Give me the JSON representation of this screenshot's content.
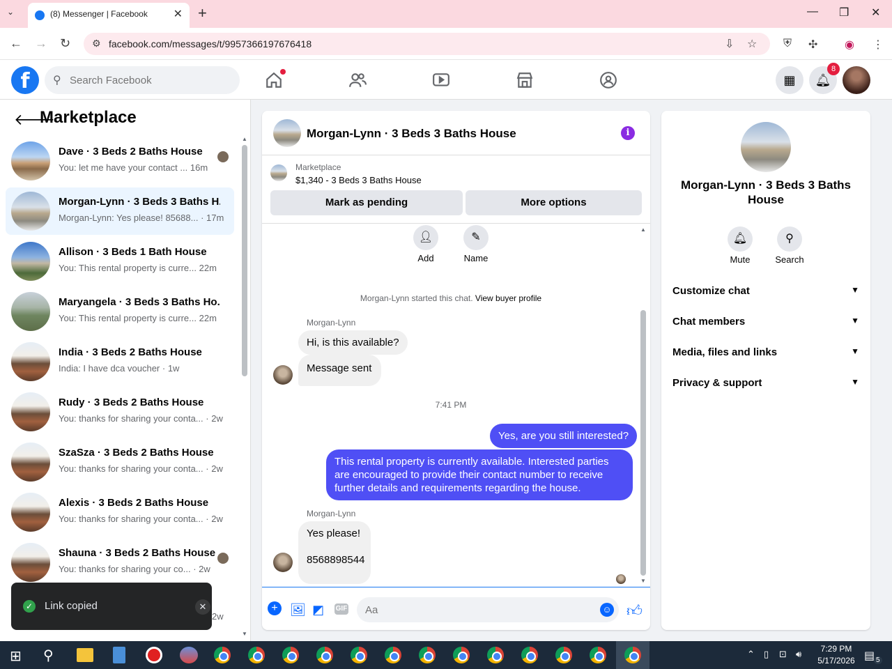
{
  "browser": {
    "tab_title": "(8) Messenger | Facebook",
    "url": "facebook.com/messages/t/9957366197676418"
  },
  "header": {
    "search_placeholder": "Search Facebook",
    "notification_count": "8"
  },
  "sidebar": {
    "title": "Marketplace",
    "conversations": [
      {
        "name": "Dave · 3 Beds 2 Baths House",
        "preview": "You: let me have your contact ...",
        "time": "16m"
      },
      {
        "name": "Morgan-Lynn · 3 Beds 3 Baths H...",
        "preview": "Morgan-Lynn: Yes please! 85688...",
        "time": "· 17m"
      },
      {
        "name": "Allison · 3 Beds 1 Bath House",
        "preview": "You: This rental property is curre...",
        "time": "22m"
      },
      {
        "name": "Maryangela · 3 Beds 3 Baths Ho...",
        "preview": "You: This rental property is curre...",
        "time": "22m"
      },
      {
        "name": "India · 3 Beds 2 Baths House",
        "preview": "India: I have dca voucher",
        "time": "· 1w"
      },
      {
        "name": "Rudy · 3 Beds 2 Baths House",
        "preview": "You: thanks for sharing your conta...",
        "time": "· 2w"
      },
      {
        "name": "SzaSza · 3 Beds 2 Baths House",
        "preview": "You: thanks for sharing your conta...",
        "time": "· 2w"
      },
      {
        "name": "Alexis · 3 Beds 2 Baths House",
        "preview": "You: thanks for sharing your conta...",
        "time": "· 2w"
      },
      {
        "name": "Shauna · 3 Beds 2 Baths House",
        "preview": "You: thanks for sharing your co...",
        "time": "· 2w"
      }
    ],
    "partial_time": "2w"
  },
  "toast": {
    "message": "Link copied"
  },
  "chat": {
    "title": "Morgan-Lynn · 3 Beds 3 Baths House",
    "listing_source": "Marketplace",
    "listing_price": "$1,340 - 3 Beds 3 Baths House",
    "mark_pending": "Mark as pending",
    "more_options": "More options",
    "add_label": "Add",
    "name_label": "Name",
    "started_text": "Morgan-Lynn started this chat.",
    "buyer_profile_link": "View buyer profile",
    "sender": "Morgan-Lynn",
    "msg1": "Hi, is this available?",
    "msg2": "Message sent",
    "timestamp": "7:41 PM",
    "out1": "Yes, are you still interested?",
    "out2": "This rental property is currently available. Interested parties are encouraged to provide their contact number to receive further details and requirements regarding the house.",
    "msg3_line1": "Yes please!",
    "msg3_line2": "8568898544",
    "input_placeholder": "Aa",
    "gif_label": "GIF"
  },
  "right_panel": {
    "name": "Morgan-Lynn · 3 Beds 3 Baths House",
    "mute": "Mute",
    "search": "Search",
    "rows": [
      "Customize chat",
      "Chat members",
      "Media, files and links",
      "Privacy & support"
    ]
  },
  "taskbar": {
    "time": "7:29 PM",
    "date": "5/17/2026",
    "notif": "5"
  }
}
